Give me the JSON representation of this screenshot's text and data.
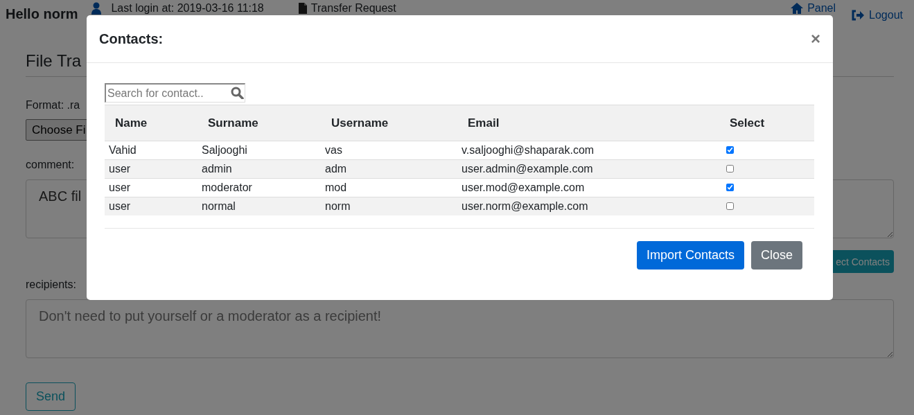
{
  "navbar": {
    "greeting": "Hello norm",
    "last_login": "Last login at: 2019-03-16 11:18",
    "links": [
      {
        "label": "Transfer Request",
        "kind": "file"
      },
      {
        "label": "Panel",
        "kind": "home"
      },
      {
        "label": "Logout",
        "kind": "logout"
      }
    ]
  },
  "form": {
    "heading": "File Tra",
    "format_label": "Format: .ra",
    "file_button": "Choose Fi",
    "comment_label": "comment:",
    "comment_value": "ABC fil",
    "select_contacts_button": "ect Contacts",
    "recipients_label": "recipients:",
    "recipients_placeholder": "Don't need to put yourself or a moderator as a recipient!",
    "send_button": "Send"
  },
  "modal": {
    "title": "Contacts:",
    "close": "×",
    "search": {
      "placeholder": "Search for contact.."
    },
    "columns": [
      "Name",
      "Surname",
      "Username",
      "Email",
      "Select"
    ],
    "rows": [
      {
        "cells": [
          "Vahid",
          "Saljooghi",
          "vas",
          "v.saljooghi@shaparak.com"
        ],
        "checked": true
      },
      {
        "cells": [
          "user",
          "admin",
          "adm",
          "user.admin@example.com"
        ],
        "checked": false
      },
      {
        "cells": [
          "user",
          "moderator",
          "mod",
          "user.mod@example.com"
        ],
        "checked": true
      },
      {
        "cells": [
          "user",
          "normal",
          "norm",
          "user.norm@example.com"
        ],
        "checked": false
      }
    ],
    "buttons": [
      {
        "label": "Import Contacts",
        "kind": "primary"
      },
      {
        "label": "Close",
        "kind": "secondary"
      }
    ]
  }
}
